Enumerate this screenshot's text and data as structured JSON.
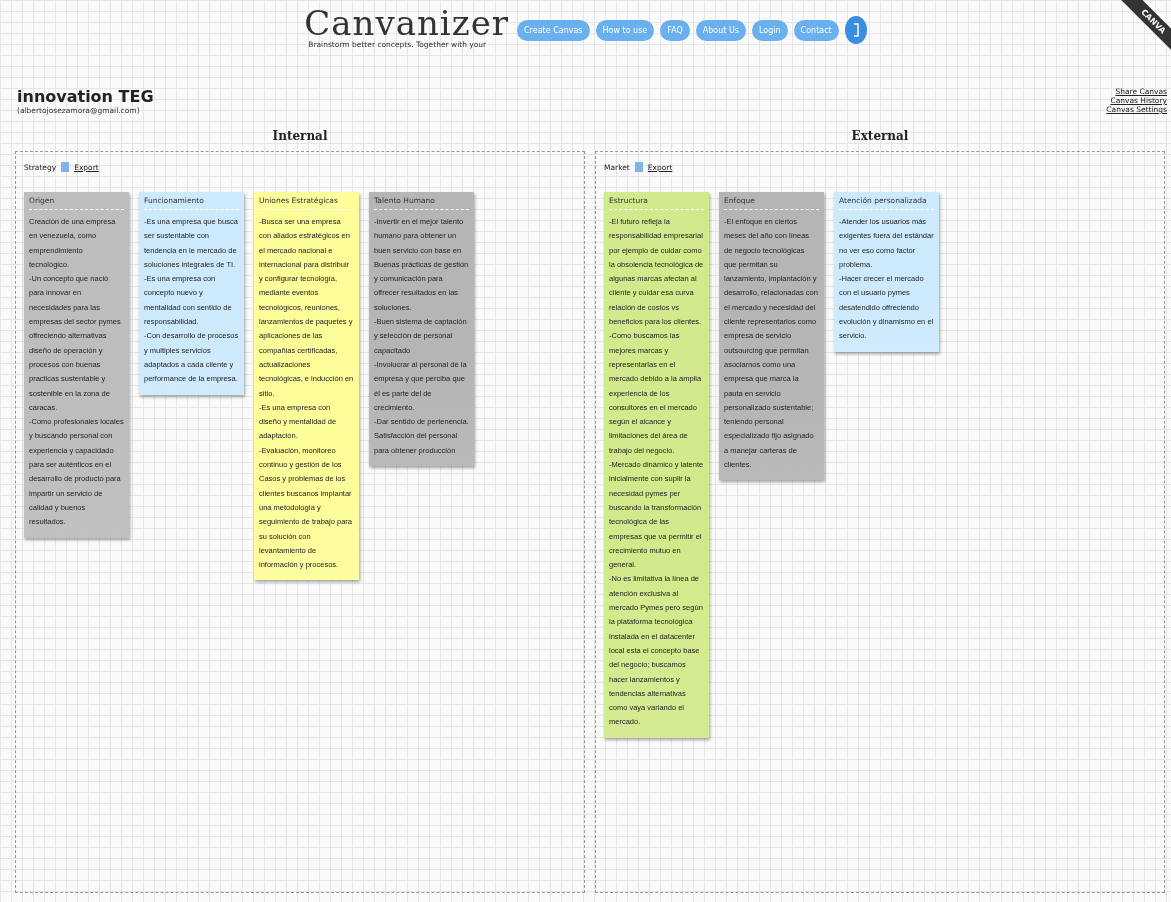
{
  "header": {
    "logo": "Canvanizer",
    "tagline": "Brainstorm better concepts. Together with your",
    "nav": [
      "Create Canvas",
      "How to use",
      "FAQ",
      "About Us",
      "Login",
      "Contact"
    ],
    "ribbon": "CANVA"
  },
  "canvas": {
    "title": "innovation TEG",
    "owner": "(albertojosezamora@gmail.com)",
    "links": [
      "Share Canvas",
      "Canvas History",
      "Canvas Settings"
    ]
  },
  "sections": [
    {
      "heading": "Internal",
      "label": "Strategy",
      "export": "Export",
      "notes": [
        {
          "title": "Origen",
          "color": "#bdbdbd",
          "text": [
            "Creación de una empresa en venezuela, como emprendimiento tecnológico.",
            "-Un concepto que nació para innovar en necesidades para las empresas del sector pymes offreciendo alternativas diseño de operación y procesos con buenas practicas sustentable y sostenible en la zona de caracas.",
            "-Como profesionales locales y buscando personal con experiencia y capacidado para ser auténticos en el desarrollo de producto para impartir un servicio de calidad y buenos resultados."
          ]
        },
        {
          "title": "Funcionamiento",
          "color": "#cdeafd",
          "text": [
            "-Es una empresa que busca ser sustentable con tendencia en le mercado de soluciones integrales de TI.",
            "-Es una empresa con concepto nuevo y mentalidad con sentido de responsabilidad.",
            "-Con desarrollo de procesos y multiples servicios adaptados a cada cliente y performance de la empresa."
          ]
        },
        {
          "title": "Uniones Estratégicas",
          "color": "#fdfd9a",
          "text": [
            "-Busca ser una empresa con aliados estratégicos en el mercado nacional e internacional para distribuir y configurar tecnología, mediante eventos tecnológicos, reuniones, lanzamientos de paquetes y aplicaciones de las compañias certificadas, actualizaciones tecnológicas, e inducción en sitio.",
            "-Es una empresa con diseño y mentalidad de adaptación.",
            "-Evaluación, monitoreo continuo y gestión de los Casos y problemas de los clientes buscanos implantar una metodología y seguimiento de trabajo para su solución con levantamiento de información y procesos."
          ]
        },
        {
          "title": "Talento Humano",
          "color": "#b5b5b5",
          "text": [
            "-Invertir en el mejor talento humano para obtener un buen servicio con base en Buenas prácticas de gestión y comunicación para offrecer resultados en las soluciones.",
            "-Buen sistema de captación y selección de personal capacitado",
            "-Involucrar al personal de la empresa y que perciba que él es parte del de crecimiento.",
            "-Dar sentido de pertenencia. Satisfacción del personal para obtener producción"
          ]
        }
      ]
    },
    {
      "heading": "External",
      "label": "Market",
      "export": "Export",
      "notes": [
        {
          "title": "Estructura",
          "color": "#d3ea8c",
          "text": [
            "-El futuro refleja la responsabilidad empresarial por ejemplo de cuidar como la obsolencia tecnológica de algunas marcas afectan al cliente y cuidar esa curva relación de costos vs beneficios para los clientes.",
            "-Como buscamos las mejores marcas y representarlas en el mercado debido a la amplia experiencia de los consultores en el mercado según el alcance y limitaciones del área de trabajo del negocio.",
            "-Mercado dinámico y latente inicialmente con suplir la necesidad pymes per buscando la transformación tecnológica de las empresas que va permitir el crecimiento mutuo en general.",
            "-No es limitativa la línea de atención exclusiva al mercado Pymes pero según la plataforma tecnológica instalada en el datacenter local esta el concepto base del negocio; buscamos hacer lanzamientos y tendencias alternativas como vaya variando el mercado."
          ]
        },
        {
          "title": "Enfoque",
          "color": "#b5b5b5",
          "text": [
            "-El enfoque en ciertos meses del año con líneas de negocio tecnológicas que permitan su lanzamiento, implantación y desarrollo, relacionadas con el mercado y necesidad del cliente representarlos como empresa de servicio outsourcing que permitan asociarnos como una empresa que marca la pauta en servicio personalizado sustentable; teniendo personal especializado fijo asignado a manejar carteras de clientes."
          ]
        },
        {
          "title": "Atención personalizada",
          "color": "#cdeafd",
          "text": [
            "-Atender los usuarios más exigentes fuera del estándar no ver eso como factor problema.",
            "-Hacer crecer el mercado con el usuario pymes desatendido offreciendo evolución y dinamismo en el servicio."
          ]
        }
      ]
    }
  ]
}
